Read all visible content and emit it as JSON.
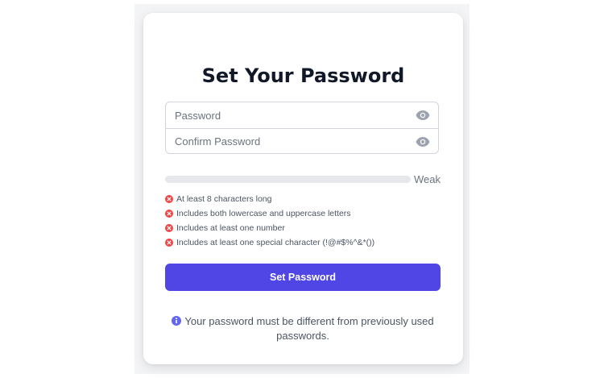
{
  "title": "Set Your Password",
  "fields": {
    "password": {
      "placeholder": "Password",
      "value": ""
    },
    "confirm": {
      "placeholder": "Confirm Password",
      "value": ""
    }
  },
  "strength": {
    "label": "Weak",
    "level": 0,
    "color": "#ef4444"
  },
  "requirements": [
    {
      "text": "At least 8 characters long",
      "met": false
    },
    {
      "text": "Includes both lowercase and uppercase letters",
      "met": false
    },
    {
      "text": "Includes at least one number",
      "met": false
    },
    {
      "text": "Includes at least one special character (!@#$%^&*())",
      "met": false
    }
  ],
  "submit_label": "Set Password",
  "note": "Your password must be different from previously used passwords.",
  "icons": {
    "toggle": "eye-icon",
    "requirement": "x-circle-icon",
    "note": "info-icon"
  },
  "colors": {
    "accent": "#4f46e5",
    "error": "#ef4444",
    "info": "#6366f1"
  }
}
